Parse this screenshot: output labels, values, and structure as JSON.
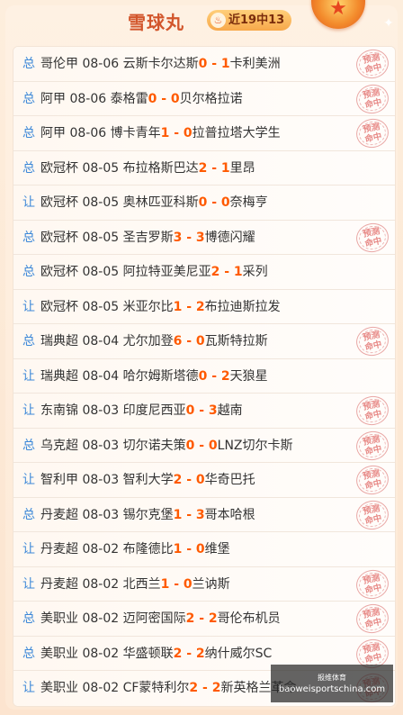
{
  "header": {
    "title": "雪球丸",
    "streak_badge": "近19中13",
    "streak_icon": "flame-icon",
    "medal_icon": "star-medal-icon"
  },
  "stamp": {
    "line1": "预测",
    "line2": "命中"
  },
  "rows": [
    {
      "type": "总",
      "league": "哥伦甲",
      "date": "08-06",
      "home": "云斯卡尔达斯",
      "hs": "0",
      "as": "1",
      "away": "卡利美洲",
      "hit": true
    },
    {
      "type": "总",
      "league": "阿甲",
      "date": "08-06",
      "home": "泰格雷",
      "hs": "0",
      "as": "0",
      "away": "贝尔格拉诺",
      "hit": true
    },
    {
      "type": "总",
      "league": "阿甲",
      "date": "08-06",
      "home": "博卡青年",
      "hs": "1",
      "as": "0",
      "away": "拉普拉塔大学生",
      "hit": true
    },
    {
      "type": "总",
      "league": "欧冠杯",
      "date": "08-05",
      "home": "布拉格斯巴达",
      "hs": "2",
      "as": "1",
      "away": "里昂",
      "hit": false
    },
    {
      "type": "让",
      "league": "欧冠杯",
      "date": "08-05",
      "home": "奥林匹亚科斯",
      "hs": "0",
      "as": "0",
      "away": "奈梅亨",
      "hit": false
    },
    {
      "type": "总",
      "league": "欧冠杯",
      "date": "08-05",
      "home": "圣吉罗斯",
      "hs": "3",
      "as": "3",
      "away": "博德闪耀",
      "hit": true
    },
    {
      "type": "总",
      "league": "欧冠杯",
      "date": "08-05",
      "home": "阿拉特亚美尼亚",
      "hs": "2",
      "as": "1",
      "away": "采列",
      "hit": false
    },
    {
      "type": "让",
      "league": "欧冠杯",
      "date": "08-05",
      "home": "米亚尔比",
      "hs": "1",
      "as": "2",
      "away": "布拉迪斯拉发",
      "hit": false
    },
    {
      "type": "总",
      "league": "瑞典超",
      "date": "08-04",
      "home": "尤尔加登",
      "hs": "6",
      "as": "0",
      "away": "瓦斯特拉斯",
      "hit": true
    },
    {
      "type": "让",
      "league": "瑞典超",
      "date": "08-04",
      "home": "哈尔姆斯塔德",
      "hs": "0",
      "as": "2",
      "away": "天狼星",
      "hit": false
    },
    {
      "type": "让",
      "league": "东南锦",
      "date": "08-03",
      "home": "印度尼西亚",
      "hs": "0",
      "as": "3",
      "away": "越南",
      "hit": true
    },
    {
      "type": "总",
      "league": "乌克超",
      "date": "08-03",
      "home": "切尔诺夫策",
      "hs": "0",
      "as": "0",
      "away": "LNZ切尔卡斯",
      "hit": true
    },
    {
      "type": "让",
      "league": "智利甲",
      "date": "08-03",
      "home": "智利大学",
      "hs": "2",
      "as": "0",
      "away": "华奇巴托",
      "hit": true
    },
    {
      "type": "总",
      "league": "丹麦超",
      "date": "08-03",
      "home": "锡尔克堡",
      "hs": "1",
      "as": "3",
      "away": "哥本哈根",
      "hit": true
    },
    {
      "type": "让",
      "league": "丹麦超",
      "date": "08-02",
      "home": "布隆德比",
      "hs": "1",
      "as": "0",
      "away": "维堡",
      "hit": false
    },
    {
      "type": "让",
      "league": "丹麦超",
      "date": "08-02",
      "home": "北西兰",
      "hs": "1",
      "as": "0",
      "away": "兰讷斯",
      "hit": true
    },
    {
      "type": "总",
      "league": "美职业",
      "date": "08-02",
      "home": "迈阿密国际",
      "hs": "2",
      "as": "2",
      "away": "哥伦布机员",
      "hit": true
    },
    {
      "type": "总",
      "league": "美职业",
      "date": "08-02",
      "home": "华盛顿联",
      "hs": "2",
      "as": "2",
      "away": "纳什威尔SC",
      "hit": true
    },
    {
      "type": "让",
      "league": "美职业",
      "date": "08-02",
      "home": "CF蒙特利尔",
      "hs": "2",
      "as": "2",
      "away": "新英格兰革命",
      "hit": true
    }
  ],
  "watermark": {
    "line1": "报维体育",
    "line2": "baoweisportschina.com"
  }
}
